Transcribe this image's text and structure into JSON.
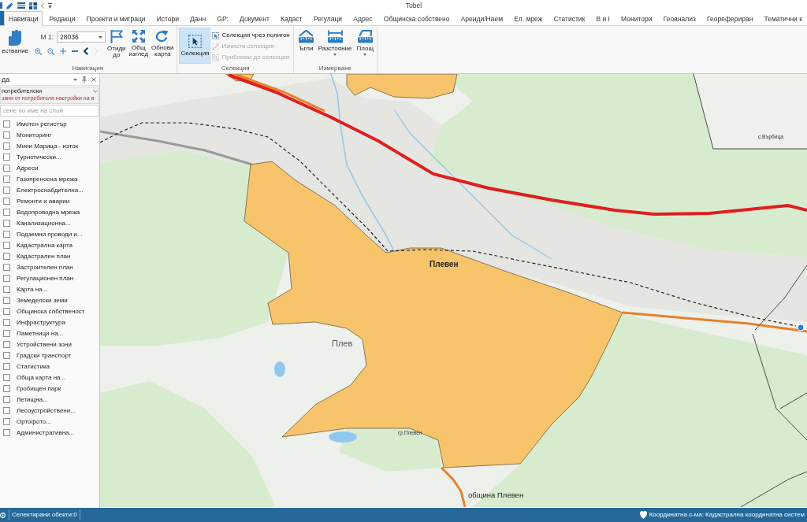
{
  "window": {
    "title": "Tobel"
  },
  "ribbon_tabs": [
    {
      "label": "Навигаци",
      "selected": true
    },
    {
      "label": "Редакци",
      "selected": false
    },
    {
      "label": "Проекти и миграци",
      "selected": false
    },
    {
      "label": "Истори",
      "selected": false
    },
    {
      "label": "Данн",
      "selected": false
    },
    {
      "label": "GP:",
      "selected": false
    },
    {
      "label": "Документ",
      "selected": false
    },
    {
      "label": "Кадаст",
      "selected": false
    },
    {
      "label": "Регулаци",
      "selected": false
    },
    {
      "label": "Адрес",
      "selected": false
    },
    {
      "label": "Общинска собствено",
      "selected": false
    },
    {
      "label": "Аренди/Наем",
      "selected": false
    },
    {
      "label": "Ел. мреж",
      "selected": false
    },
    {
      "label": "Статистик",
      "selected": false
    },
    {
      "label": "В и I",
      "selected": false
    },
    {
      "label": "Монитори",
      "selected": false
    },
    {
      "label": "Геоанализ",
      "selected": false
    },
    {
      "label": "Георефериран",
      "selected": false
    },
    {
      "label": "Тематични к",
      "selected": false
    }
  ],
  "ribbon": {
    "navigation": {
      "label": "Навигация",
      "pan_tool": {
        "label": "ествание",
        "selected": false
      },
      "scale": {
        "label": "М 1:",
        "value": "28036"
      },
      "view_tools": [
        {
          "disabled": false
        },
        {
          "disabled": false
        },
        {
          "disabled": false
        },
        {
          "disabled": false
        },
        {
          "disabled": false
        },
        {
          "disabled": true
        }
      ],
      "actions": [
        "Отиди до",
        "Общ изглед",
        "Обнови карта"
      ]
    },
    "selection": {
      "label": "Селекция",
      "select_tool": {
        "label": "Селекция",
        "selected": true
      },
      "commands": [
        {
          "label": "Селекция чрез полигон",
          "disabled": false
        },
        {
          "label": "Изчисти селекция",
          "disabled": true
        },
        {
          "label": "Приближи до селекция",
          "disabled": true
        }
      ]
    },
    "measure": {
      "label": "Измерване",
      "tools": [
        {
          "label": "Ъгли",
          "dropdown": false,
          "selected": false
        },
        {
          "label": "Разстояние",
          "dropdown": true,
          "selected": false
        },
        {
          "label": "Площ",
          "dropdown": true,
          "selected": false
        }
      ]
    }
  },
  "layers_panel": {
    "title": "да",
    "profile": {
      "value": "потребителски",
      "note": "зани от потребителя настройки на в"
    },
    "search": {
      "placeholder": "сене по име на слой"
    },
    "layers": [
      {
        "label": "Имотен регистър",
        "checked": false
      },
      {
        "label": "Мониторинг",
        "checked": false
      },
      {
        "label": "Мини Марица - изток",
        "checked": false
      },
      {
        "label": "Туристически...",
        "checked": false
      },
      {
        "label": "Адреси",
        "checked": false
      },
      {
        "label": "Газопреносна мрежа",
        "checked": false
      },
      {
        "label": "Електроснабдителна...",
        "checked": false
      },
      {
        "label": "Ремонти и аварии",
        "checked": false
      },
      {
        "label": "Водопроводна мрежа",
        "checked": false
      },
      {
        "label": "Канализационна...",
        "checked": false
      },
      {
        "label": "Подземни проводи и...",
        "checked": false
      },
      {
        "label": "Кадастрална карта",
        "checked": false
      },
      {
        "label": "Кадастрален план",
        "checked": false
      },
      {
        "label": "Застроителен план",
        "checked": false
      },
      {
        "label": "Регулационен план",
        "checked": false
      },
      {
        "label": "Карта на...",
        "checked": false
      },
      {
        "label": "Земеделски земи",
        "checked": false
      },
      {
        "label": "Общинска собственост",
        "checked": false
      },
      {
        "label": "Инфраструктура",
        "checked": false
      },
      {
        "label": "Паметници на...",
        "checked": false
      },
      {
        "label": "Устройствени зони",
        "checked": false
      },
      {
        "label": "Градски транспорт",
        "checked": false
      },
      {
        "label": "Статистика",
        "checked": false
      },
      {
        "label": "Обща карта на...",
        "checked": false
      },
      {
        "label": "Гробищен парк",
        "checked": false
      },
      {
        "label": "Летищна...",
        "checked": false
      },
      {
        "label": "Лесоустройствени...",
        "checked": false
      },
      {
        "label": "Ортофото...",
        "checked": false
      },
      {
        "label": "Административна...",
        "checked": false
      }
    ]
  },
  "map": {
    "labels": [
      {
        "text": "Плевен",
        "kind": "city"
      },
      {
        "text": "Плев",
        "kind": "district"
      },
      {
        "text": "община Плевен",
        "kind": "municipality"
      },
      {
        "text": "гр.Плевен",
        "kind": "village"
      },
      {
        "text": "с.Върбица",
        "kind": "village"
      }
    ]
  },
  "status_bar": {
    "selected_objects": "Селектирани обекти:0",
    "coordinate_system": "Координатна с-ма: Кадастрална координатна систем"
  }
}
